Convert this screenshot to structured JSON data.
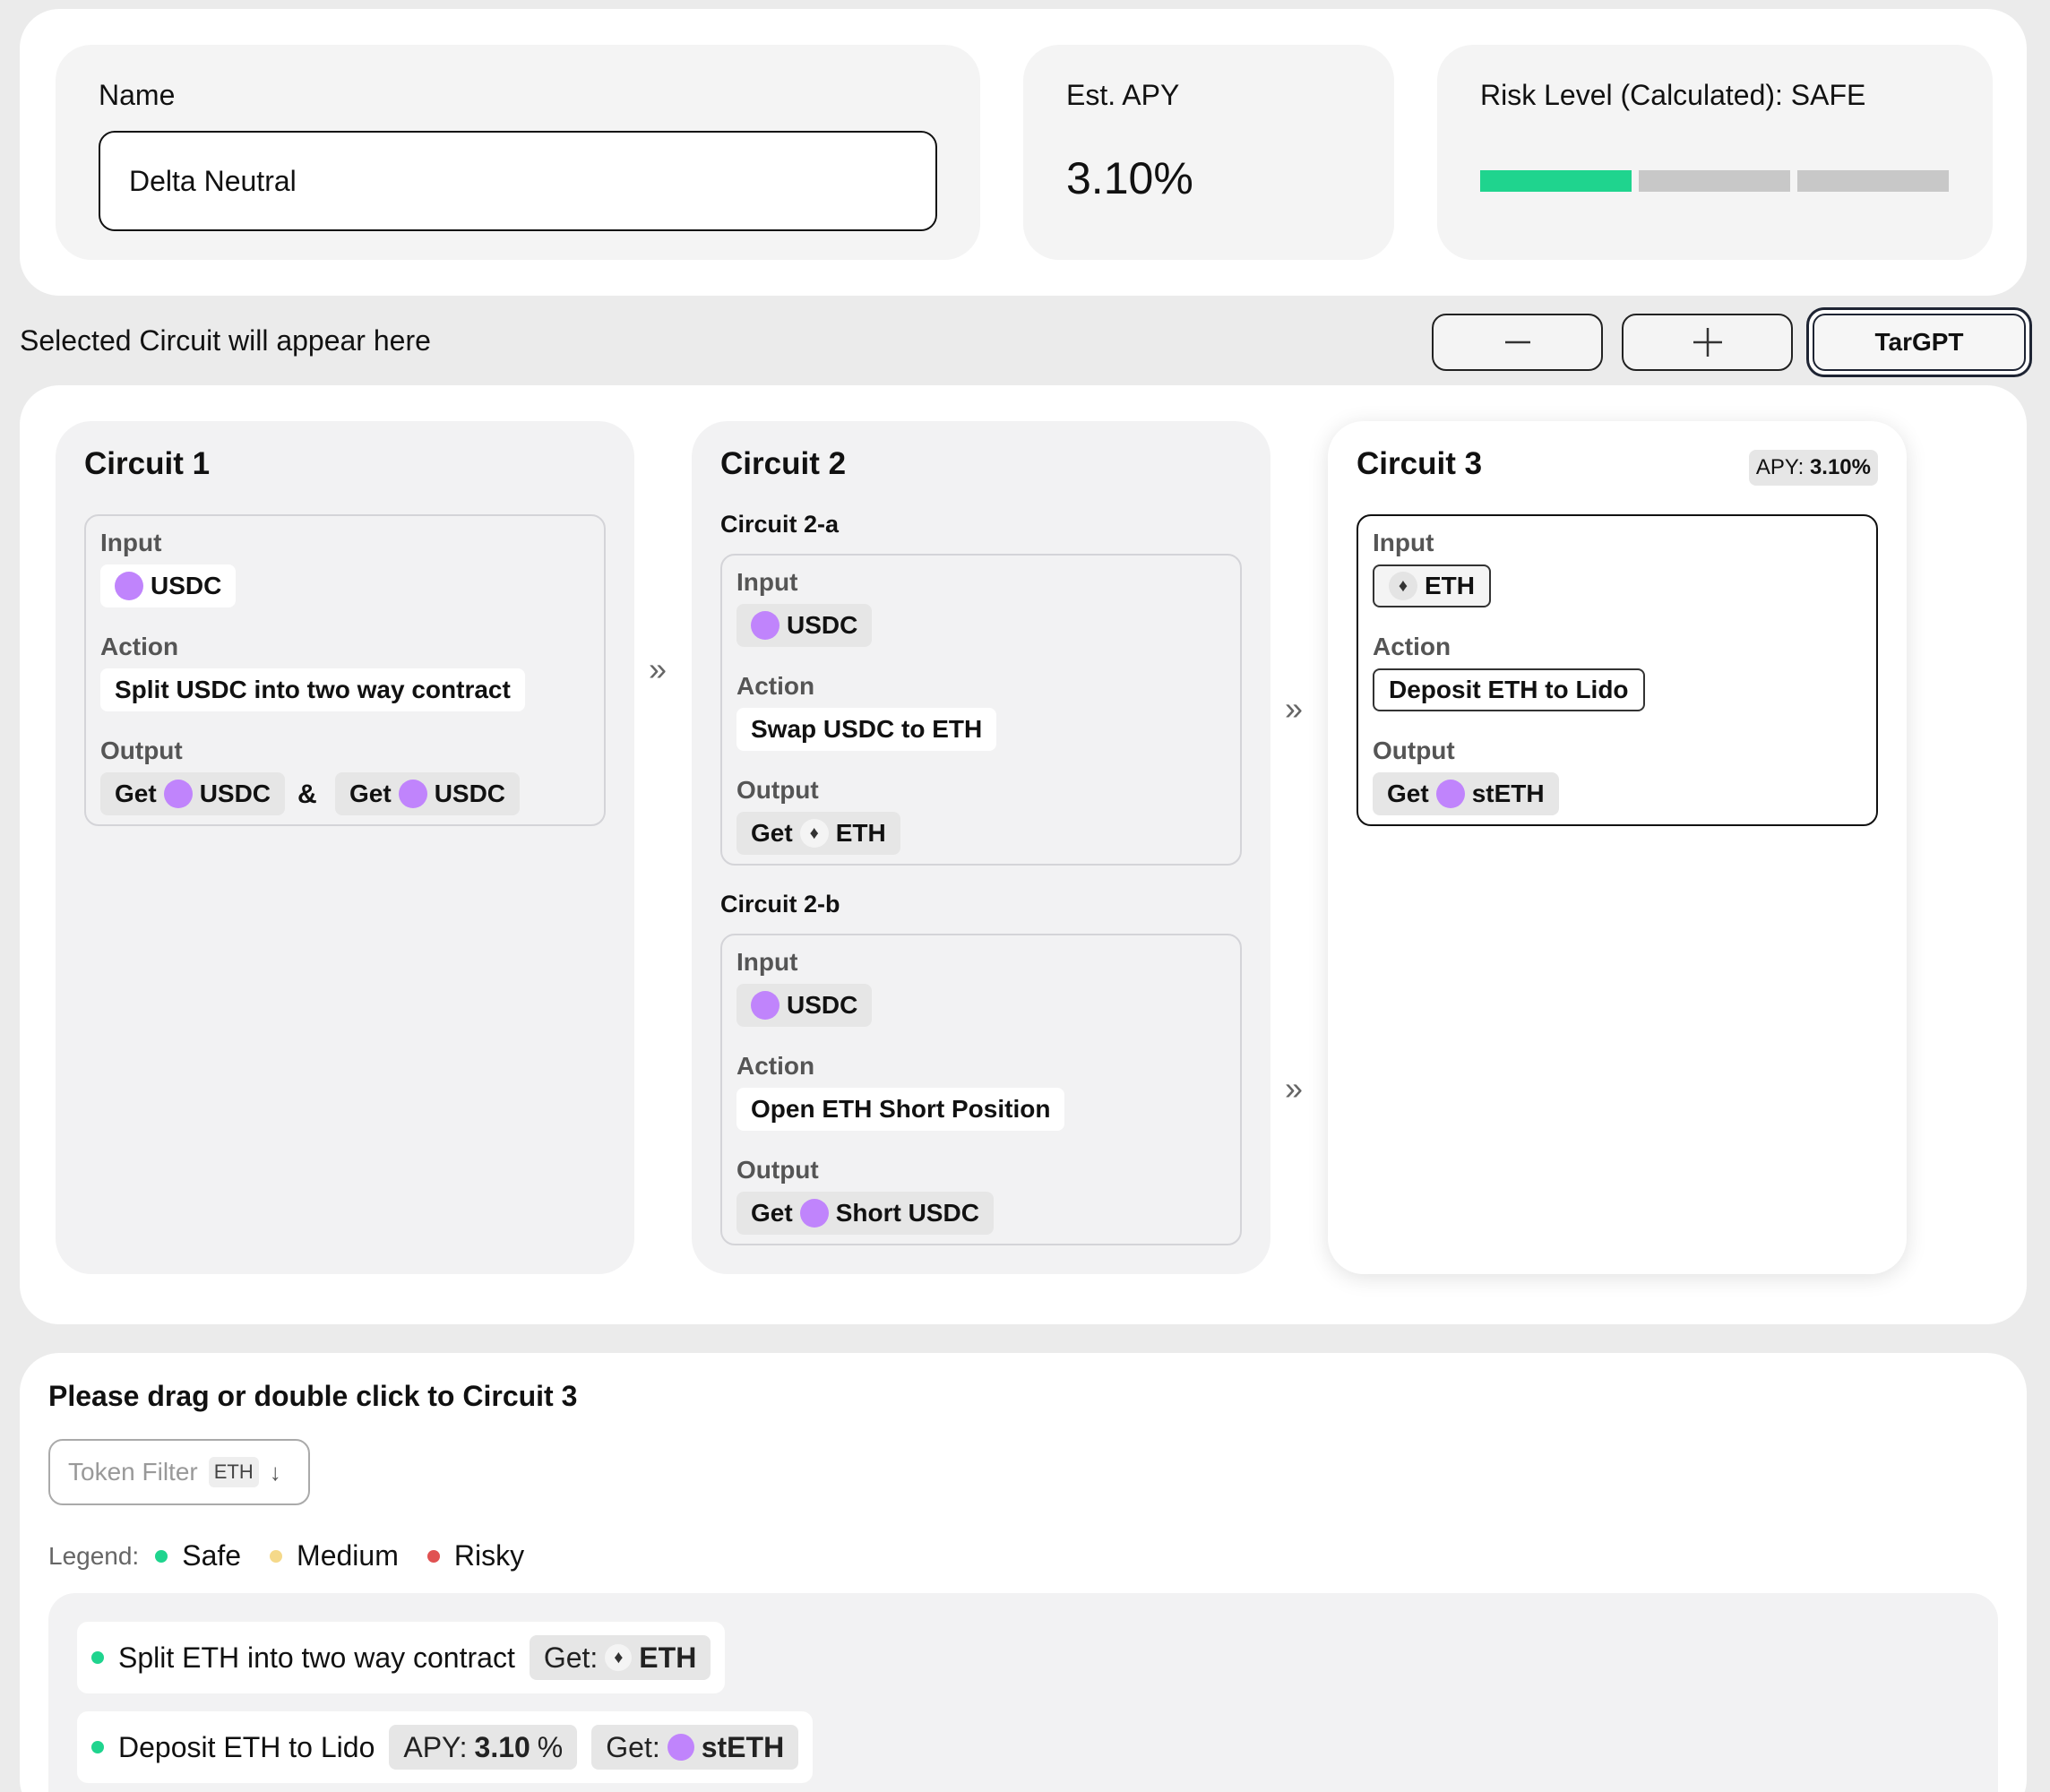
{
  "header": {
    "name_label": "Name",
    "name_value": "Delta Neutral",
    "apy_label": "Est. APY",
    "apy_value": "3.10%",
    "risk_label": "Risk Level (Calculated): SAFE",
    "risk_level_filled": 1,
    "risk_level_total": 3,
    "risk_color": "#1fd48e"
  },
  "toolbar": {
    "selected_text": "Selected Circuit will appear here",
    "minus_icon": "minus-icon",
    "plus_icon": "plus-icon",
    "targpt_label": "TarGPT"
  },
  "circuits": {
    "c1": {
      "title": "Circuit 1",
      "input_label": "Input",
      "input_token": "USDC",
      "action_label": "Action",
      "action": "Split USDC into two way contract",
      "output_label": "Output",
      "output1_prefix": "Get",
      "output1_token": "USDC",
      "amp": "&",
      "output2_prefix": "Get",
      "output2_token": "USDC"
    },
    "c2": {
      "title": "Circuit 2",
      "a": {
        "subtitle": "Circuit 2-a",
        "input_label": "Input",
        "input_token": "USDC",
        "action_label": "Action",
        "action": "Swap USDC to ETH",
        "output_label": "Output",
        "output_prefix": "Get",
        "output_token": "ETH"
      },
      "b": {
        "subtitle": "Circuit 2-b",
        "input_label": "Input",
        "input_token": "USDC",
        "action_label": "Action",
        "action": "Open ETH Short Position",
        "output_label": "Output",
        "output_prefix": "Get",
        "output_token": "Short USDC"
      }
    },
    "c3": {
      "title": "Circuit 3",
      "apy_prefix": "APY:",
      "apy_value": "3.10%",
      "input_label": "Input",
      "input_token": "ETH",
      "action_label": "Action",
      "action": "Deposit ETH to Lido",
      "output_label": "Output",
      "output_prefix": "Get",
      "output_token": "stETH"
    },
    "arrow_glyph": "»"
  },
  "library": {
    "instruction": "Please drag or double click to Circuit 3",
    "filter_placeholder": "Token Filter",
    "filter_tag": "ETH",
    "legend_title": "Legend:",
    "legend": [
      {
        "label": "Safe",
        "color": "#1fd48e"
      },
      {
        "label": "Medium",
        "color": "#f5d98a"
      },
      {
        "label": "Risky",
        "color": "#e05252"
      }
    ],
    "strategies": [
      {
        "label": "Split ETH into two way contract",
        "get_prefix": "Get:",
        "get_token": "ETH",
        "risk_color": "#1fd48e"
      },
      {
        "label": "Deposit ETH to Lido",
        "apy_prefix": "APY:",
        "apy_value": "3.10",
        "apy_unit": "%",
        "get_prefix": "Get:",
        "get_token": "stETH",
        "risk_color": "#1fd48e"
      }
    ]
  }
}
